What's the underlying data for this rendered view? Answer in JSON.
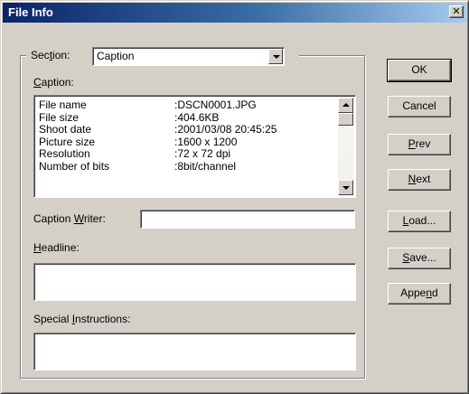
{
  "window": {
    "title": "File Info"
  },
  "section": {
    "label_pre": "Sec",
    "label_key": "t",
    "label_post": "ion:",
    "selected": "Caption"
  },
  "caption": {
    "label_key": "C",
    "label_post": "aption:",
    "rows": [
      {
        "key": "File name",
        "value": ":DSCN0001.JPG"
      },
      {
        "key": "File size",
        "value": ":404.6KB"
      },
      {
        "key": "Shoot date",
        "value": ":2001/03/08 20:45:25"
      },
      {
        "key": "Picture size",
        "value": ":1600 x 1200"
      },
      {
        "key": "Resolution",
        "value": ":72 x 72 dpi"
      },
      {
        "key": "Number of bits",
        "value": ":8bit/channel"
      }
    ]
  },
  "caption_writer": {
    "label_pre": "Caption ",
    "label_key": "W",
    "label_post": "riter:",
    "value": ""
  },
  "headline": {
    "label_key": "H",
    "label_post": "eadline:",
    "value": ""
  },
  "special_instructions": {
    "label_pre": "Special ",
    "label_key": "I",
    "label_post": "nstructions:",
    "value": ""
  },
  "buttons": {
    "ok": "OK",
    "cancel": "Cancel",
    "prev_key": "P",
    "prev_post": "rev",
    "next_key": "N",
    "next_post": "ext",
    "load_key": "L",
    "load_post": "oad...",
    "save_key": "S",
    "save_post": "ave...",
    "append_pre": "Appe",
    "append_key": "n",
    "append_post": "d"
  }
}
